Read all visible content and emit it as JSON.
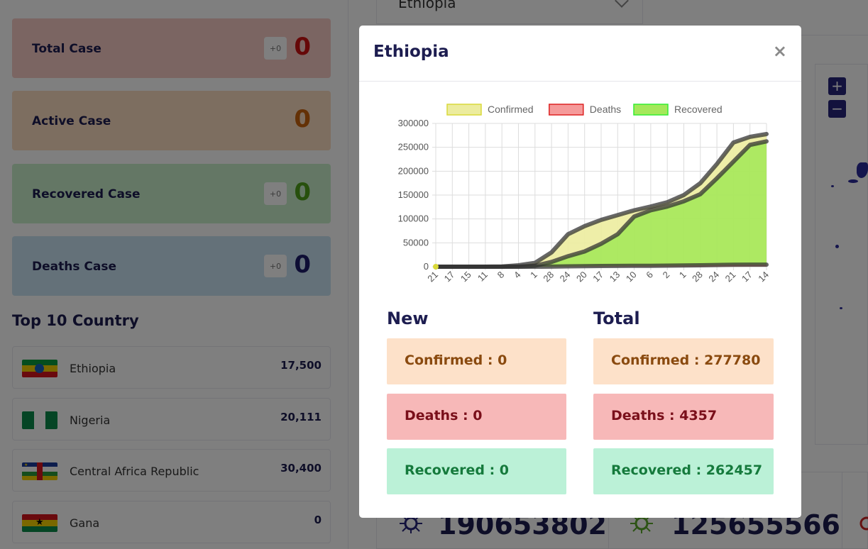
{
  "stats": [
    {
      "label": "Total Case",
      "delta": "+0",
      "value": "0",
      "color": "#cc1111",
      "bg": "#f6cbc5"
    },
    {
      "label": "Active Case",
      "delta": "",
      "value": "0",
      "color": "#c8630c",
      "bg": "#fbddc0"
    },
    {
      "label": "Recovered Case",
      "delta": "+0",
      "value": "0",
      "color": "#4fa01a",
      "bg": "#c9efcb"
    },
    {
      "label": "Deaths Case",
      "delta": "+0",
      "value": "0",
      "color": "#1d1d6a",
      "bg": "#c9e2f2"
    }
  ],
  "top_countries": {
    "title": "Top 10 Country",
    "rows": [
      {
        "name": "Ethiopia",
        "count": "17,500",
        "flag": "ethiopia-flag"
      },
      {
        "name": "Nigeria",
        "count": "20,111",
        "flag": "nigeria-flag"
      },
      {
        "name": "Central Africa Republic",
        "count": "30,400",
        "flag": "central-african-republic-flag"
      },
      {
        "name": "Gana",
        "count": "0",
        "flag": "ghana-flag"
      }
    ]
  },
  "country_select": {
    "value": "Ethiopia"
  },
  "map_controls": {
    "zoom_in": "+",
    "zoom_out": "−"
  },
  "bottom_stats": [
    "190653802",
    "125655566"
  ],
  "modal": {
    "title": "Ethiopia",
    "close": "×",
    "new": {
      "title": "New",
      "confirmed": "Confirmed : 0",
      "deaths": "Deaths : 0",
      "recovered": "Recovered : 0"
    },
    "total": {
      "title": "Total",
      "confirmed": "Confirmed : 277780",
      "deaths": "Deaths : 4357",
      "recovered": "Recovered : 262457"
    }
  },
  "chart_data": {
    "type": "area",
    "x": [
      "21",
      "17",
      "15",
      "11",
      "8",
      "4",
      "1",
      "28",
      "24",
      "20",
      "17",
      "13",
      "10",
      "6",
      "2",
      "1",
      "28",
      "24",
      "21",
      "17",
      "14"
    ],
    "ylim": [
      0,
      300000
    ],
    "yticks": [
      "0",
      "50000",
      "100000",
      "150000",
      "200000",
      "250000",
      "300000"
    ],
    "grid": true,
    "legend_position": "top",
    "series": [
      {
        "name": "Confirmed",
        "color": "#d9d93a",
        "fill": "#ecec9e",
        "values": [
          0,
          0,
          0,
          0,
          500,
          3000,
          8000,
          30000,
          68000,
          85000,
          98000,
          108000,
          118000,
          126000,
          135000,
          150000,
          175000,
          215000,
          260000,
          272000,
          277780
        ]
      },
      {
        "name": "Deaths",
        "color": "#dd2222",
        "fill": "#f59a9a",
        "values": [
          0,
          0,
          0,
          0,
          0,
          0,
          50,
          200,
          800,
          1200,
          1500,
          1700,
          1900,
          2000,
          2200,
          2500,
          2900,
          3500,
          4000,
          4300,
          4357
        ]
      },
      {
        "name": "Recovered",
        "color": "#33ee33",
        "fill": "#a5e85a",
        "values": [
          0,
          0,
          0,
          0,
          0,
          0,
          2000,
          10000,
          22000,
          32000,
          48000,
          68000,
          105000,
          118000,
          126000,
          137000,
          152000,
          185000,
          220000,
          255000,
          262457
        ]
      }
    ]
  }
}
